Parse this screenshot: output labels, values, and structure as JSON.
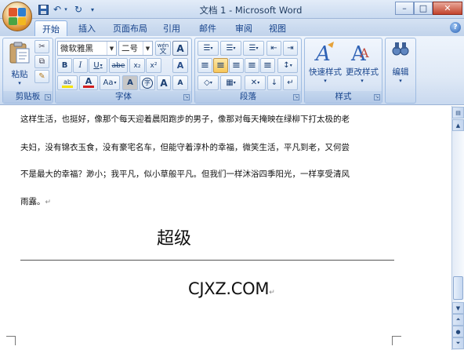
{
  "window": {
    "title": "文档 1 - Microsoft Word",
    "minimize": "–",
    "maximize": "□",
    "close": "✕"
  },
  "quick_access": {
    "save_icon": "save-icon",
    "undo_icon": "undo-icon",
    "redo_icon": "redo-icon",
    "customize_icon": "chevron-down-icon"
  },
  "tabs": [
    {
      "label": "开始",
      "active": true
    },
    {
      "label": "插入"
    },
    {
      "label": "页面布局"
    },
    {
      "label": "引用"
    },
    {
      "label": "邮件"
    },
    {
      "label": "审阅"
    },
    {
      "label": "视图"
    }
  ],
  "help": "?",
  "ribbon": {
    "clipboard": {
      "label": "剪贴板",
      "paste": "粘贴",
      "cut": "✂",
      "copy": "⧉",
      "format_painter": "✎"
    },
    "font": {
      "label": "字体",
      "font_name": "微软雅黑",
      "font_size": "二号",
      "grow": "A",
      "shrink": "A",
      "wen": "wén",
      "bold": "B",
      "italic": "I",
      "underline": "U",
      "strike": "abe",
      "subscript": "x₂",
      "superscript": "x²",
      "aa": "Aa",
      "font_color": "A",
      "highlight": "ab",
      "char_shading": "A",
      "char_border": "A",
      "enclose": "字",
      "clear": "A"
    },
    "paragraph": {
      "label": "段落",
      "bullets": "☰",
      "numbering": "☰",
      "multilevel": "☰",
      "decrease_indent": "⇤",
      "increase_indent": "⇥",
      "align_left": "≡",
      "align_center": "≡",
      "align_right": "≡",
      "justify": "≡",
      "distributed": "≡",
      "line_spacing": "↕",
      "shading": "◇",
      "borders": "▦",
      "chinese_layout": "✕",
      "sort": "↓",
      "show_marks": "↵"
    },
    "styles": {
      "label": "样式",
      "quick_styles": "快速样式",
      "change_styles": "更改样式"
    },
    "editing": {
      "label": "编辑"
    }
  },
  "document": {
    "lines": [
      "这样生活，也挺好，像那个每天迎着晨阳跑步的男子，像那对每天掩映在绿柳下打太极的老",
      "夫妇，没有锦衣玉食，没有豪宅名车，但能守着淳朴的幸福，微笑生活，平凡到老，又何尝",
      "不是最大的幸福？渺小；我平凡，似小草般平凡。但我们一样沐浴四季阳光，一样享受清风",
      "雨露。"
    ],
    "paragraph_mark": "↵",
    "heading": "超级",
    "website": "CJXZ.COM"
  },
  "colors": {
    "accent": "#15428b",
    "ribbon": "#dfe9f6",
    "font_color_bar": "#d21f1f",
    "highlight_bar": "#f4e200"
  }
}
